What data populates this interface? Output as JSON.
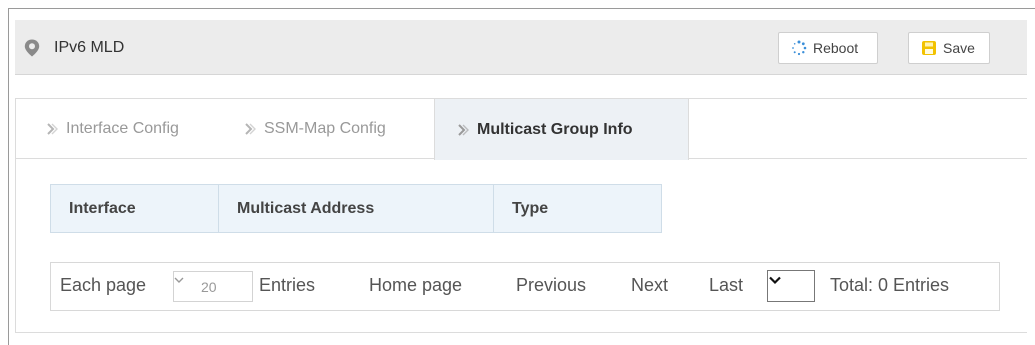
{
  "header": {
    "title": "IPv6 MLD",
    "title_icon": "location-pin-icon",
    "reboot_label": "Reboot",
    "reboot_icon": "spinner-icon",
    "save_label": "Save",
    "save_icon": "floppy-disk-icon"
  },
  "tabs": [
    {
      "label": "Interface Config",
      "active": false
    },
    {
      "label": "SSM-Map Config",
      "active": false
    },
    {
      "label": "Multicast Group Info",
      "active": true
    }
  ],
  "table": {
    "columns": [
      "Interface",
      "Multicast Address",
      "Type"
    ],
    "rows": []
  },
  "pager": {
    "each_page_label": "Each page",
    "page_size": "20",
    "entries_label": "Entries",
    "home_label": "Home page",
    "previous_label": "Previous",
    "next_label": "Next",
    "last_label": "Last",
    "page_select_value": "",
    "total_label": "Total: 0 Entries"
  },
  "colors": {
    "accent_blue": "#3b8fd9",
    "save_yellow": "#f2c200",
    "active_tab_bg": "#edf1f5",
    "table_header_bg": "#edf4fa"
  }
}
